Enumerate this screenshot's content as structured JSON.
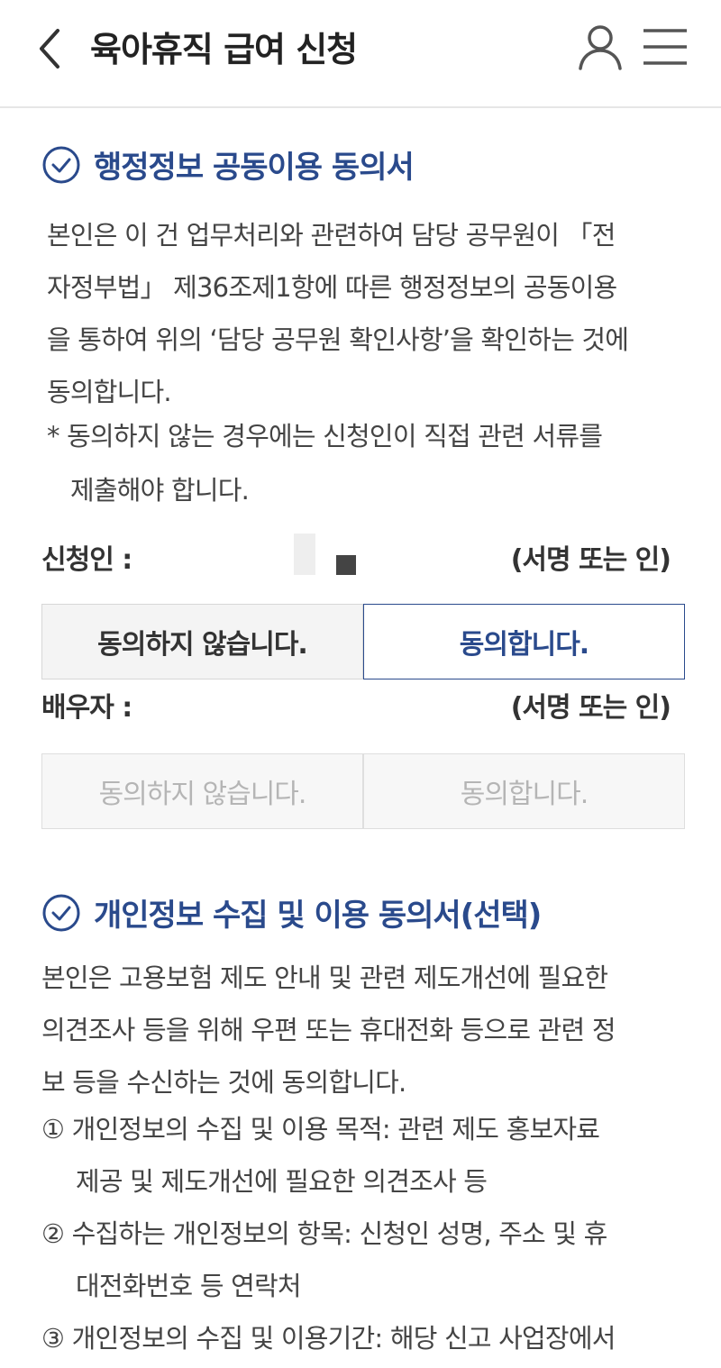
{
  "header": {
    "title": "육아휴직 급여 신청"
  },
  "section1": {
    "title": "행정정보 공동이용 동의서",
    "body_lines": [
      "본인은 이 건 업무처리와 관련하여 담당 공무원이 「전",
      "자정부법」 제36조제1항에 따른 행정정보의 공동이용",
      "을 통하여 위의 ‘담당 공무원 확인사항’을 확인하는 것에",
      "동의합니다."
    ],
    "note_lines": [
      "* 동의하지 않는 경우에는 신청인이 직접 관련 서류를",
      "제출해야 합니다."
    ]
  },
  "applicant": {
    "label": "신청인 :",
    "sign_note": "(서명 또는 인)",
    "disagree_label": "동의하지 않습니다.",
    "agree_label": "동의합니다."
  },
  "spouse": {
    "label": "배우자 :",
    "sign_note": "(서명 또는 인)",
    "disagree_label": "동의하지 않습니다.",
    "agree_label": "동의합니다."
  },
  "section2": {
    "title": "개인정보 수집 및 이용 동의서(선택)",
    "body_lines": [
      "본인은 고용보험 제도 안내 및 관련 제도개선에 필요한",
      "의견조사 등을 위해 우편 또는 휴대전화 등으로 관련 정",
      "보 등을 수신하는 것에 동의합니다."
    ],
    "items": [
      {
        "line1": "① 개인정보의 수집 및 이용 목적: 관련 제도 홍보자료",
        "line2": "제공 및 제도개선에 필요한 의견조사 등"
      },
      {
        "line1": "② 수집하는 개인정보의 항목: 신청인 성명, 주소 및 휴",
        "line2": "대전화번호 등 연락처"
      },
      {
        "line1": "③ 개인정보의 수집 및 이용기간: 해당 신고 사업장에서",
        "line2": ""
      }
    ]
  },
  "colors": {
    "accent": "#2a4a8c",
    "text": "#444444",
    "disabled_text": "#b5b5b5"
  },
  "icons": [
    "back-arrow-icon",
    "user-icon",
    "hamburger-menu-icon",
    "check-circle-icon"
  ]
}
